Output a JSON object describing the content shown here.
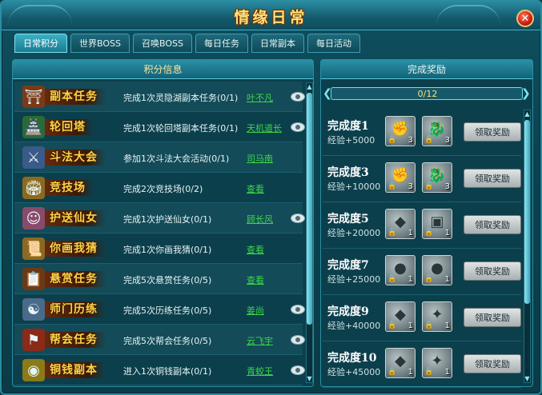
{
  "window": {
    "title": "情缘日常"
  },
  "tabs": [
    {
      "label": "日常积分",
      "active": true
    },
    {
      "label": "世界BOSS",
      "active": false
    },
    {
      "label": "召唤BOSS",
      "active": false
    },
    {
      "label": "每日任务",
      "active": false
    },
    {
      "label": "日常副本",
      "active": false
    },
    {
      "label": "每日活动",
      "active": false
    }
  ],
  "left_panel": {
    "header": "积分信息",
    "rows": [
      {
        "name": "副本任务",
        "icon": "temple-icon",
        "desc": "完成1次灵隐湖副本任务(0/1)",
        "link": "叶不凡",
        "eye": true
      },
      {
        "name": "轮回塔",
        "icon": "pagoda-icon",
        "desc": "完成1次轮回塔副本任务(0/1)",
        "link": "天机道长",
        "eye": true
      },
      {
        "name": "斗法大会",
        "icon": "crossed-swords-icon",
        "desc": "参加1次斗法大会活动(0/1)",
        "link": "司马南",
        "eye": false
      },
      {
        "name": "竞技场",
        "icon": "arena-icon",
        "desc": "完成2次竞技场(0/2)",
        "link": "查看",
        "eye": false
      },
      {
        "name": "护送仙女",
        "icon": "fairy-icon",
        "desc": "完成1次护送仙女(0/1)",
        "link": "顾长风",
        "eye": true
      },
      {
        "name": "你画我猜",
        "icon": "scroll-icon",
        "desc": "完成1次你画我猜(0/1)",
        "link": "查看",
        "eye": false
      },
      {
        "name": "悬赏任务",
        "icon": "bounty-icon",
        "desc": "完成5次悬赏任务(0/5)",
        "link": "查看",
        "eye": false
      },
      {
        "name": "师门历练",
        "icon": "master-icon",
        "desc": "完成5次历练任务(0/5)",
        "link": "姜尚",
        "eye": true
      },
      {
        "name": "帮会任务",
        "icon": "guild-icon",
        "desc": "完成5次帮会任务(0/5)",
        "link": "云飞宇",
        "eye": true
      },
      {
        "name": "铜钱副本",
        "icon": "coin-icon",
        "desc": "进入1次铜钱副本(0/1)",
        "link": "青蛟王",
        "eye": true
      }
    ]
  },
  "right_panel": {
    "header": "完成奖励",
    "progress": {
      "text": "0/12",
      "fraction": 0
    },
    "claim_label": "领取奖励",
    "rewards": [
      {
        "name": "完成度1",
        "exp": "经验+5000",
        "items": [
          {
            "icon": "fist-icon",
            "count": "3"
          },
          {
            "icon": "dragon-icon",
            "count": "3"
          }
        ]
      },
      {
        "name": "完成度3",
        "exp": "经验+10000",
        "items": [
          {
            "icon": "fist-icon",
            "count": "3"
          },
          {
            "icon": "dragon-icon",
            "count": "3"
          }
        ]
      },
      {
        "name": "完成度5",
        "exp": "经验+20000",
        "items": [
          {
            "icon": "stone-icon",
            "count": "1"
          },
          {
            "icon": "cube-icon",
            "count": "1"
          }
        ]
      },
      {
        "name": "完成度7",
        "exp": "经验+25000",
        "items": [
          {
            "icon": "orb-icon",
            "count": "1"
          },
          {
            "icon": "orb-icon",
            "count": "1"
          }
        ]
      },
      {
        "name": "完成度9",
        "exp": "经验+40000",
        "items": [
          {
            "icon": "stone-icon",
            "count": "1"
          },
          {
            "icon": "rune-icon",
            "count": "1"
          }
        ]
      },
      {
        "name": "完成度10",
        "exp": "经验+45000",
        "items": [
          {
            "icon": "stone-icon",
            "count": "1"
          },
          {
            "icon": "rune-icon",
            "count": "1"
          }
        ]
      }
    ]
  },
  "colors": {
    "accent": "#3db0c4",
    "title": "#ffe27a",
    "link": "#3cd84a",
    "name": "#ffd24a"
  }
}
